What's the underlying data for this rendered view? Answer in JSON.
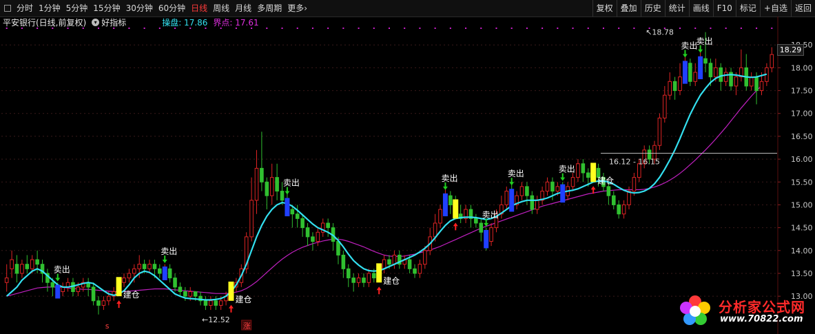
{
  "toolbar": {
    "periods": [
      "分时",
      "1分钟",
      "5分钟",
      "15分钟",
      "30分钟",
      "60分钟",
      "日线",
      "周线",
      "月线",
      "多周期",
      "更多"
    ],
    "active_period": "日线",
    "more_chevron": "›",
    "right_buttons": [
      "复权",
      "叠加",
      "历史",
      "统计",
      "画线",
      "F10",
      "标记",
      "+自选",
      "返回"
    ]
  },
  "infobar": {
    "stock_title": "平安银行(日线,前复权)",
    "indicator_name": "好指标",
    "line1_label": "操盘: 17.86",
    "line2_label": "界点: 17.61"
  },
  "colors": {
    "up": "#e02424",
    "down": "#30c030",
    "fast_line": "#33e0f0",
    "slow_line": "#c020c0",
    "buy_bar": "#ffff20",
    "sell_bar": "#2040ff",
    "grid": "#3a1a1a",
    "axis_text": "#c8c8c8"
  },
  "chart_data": {
    "type": "candlestick",
    "y_axis_ticks": [
      13.0,
      13.5,
      14.0,
      14.5,
      15.0,
      15.5,
      16.0,
      16.5,
      17.0,
      17.5,
      18.0,
      18.5
    ],
    "current_price": "18.29",
    "ylim": [
      12.55,
      18.85
    ],
    "candles": [
      [
        13.3,
        13.4,
        13.1,
        13.7
      ],
      [
        13.6,
        13.8,
        13.4,
        14.0
      ],
      [
        13.7,
        13.5,
        13.3,
        13.9
      ],
      [
        13.5,
        13.7,
        13.4,
        13.8
      ],
      [
        13.7,
        13.6,
        13.5,
        13.9
      ],
      [
        13.6,
        13.8,
        13.5,
        13.9
      ],
      [
        13.8,
        13.7,
        13.5,
        14.0
      ],
      [
        13.7,
        13.5,
        13.3,
        13.8
      ],
      [
        13.5,
        13.3,
        13.1,
        13.6
      ],
      [
        13.3,
        13.2,
        13.0,
        13.4
      ],
      [
        13.2,
        13.1,
        13.0,
        13.3
      ],
      [
        13.1,
        13.2,
        13.0,
        13.3
      ],
      [
        13.2,
        13.3,
        13.1,
        13.4
      ],
      [
        13.3,
        13.1,
        13.0,
        13.4
      ],
      [
        13.1,
        13.2,
        13.0,
        13.3
      ],
      [
        13.2,
        13.3,
        13.1,
        13.4
      ],
      [
        13.3,
        13.2,
        13.0,
        13.4
      ],
      [
        13.2,
        12.9,
        12.8,
        13.3
      ],
      [
        12.9,
        12.8,
        12.6,
        13.0
      ],
      [
        12.8,
        12.9,
        12.7,
        13.0
      ],
      [
        12.9,
        13.0,
        12.8,
        13.1
      ],
      [
        13.0,
        13.1,
        12.9,
        13.2
      ],
      [
        13.1,
        13.3,
        13.0,
        13.4
      ],
      [
        13.3,
        13.4,
        13.2,
        13.5
      ],
      [
        13.4,
        13.5,
        13.3,
        13.6
      ],
      [
        13.5,
        13.6,
        13.3,
        13.7
      ],
      [
        13.6,
        13.7,
        13.4,
        13.9
      ],
      [
        13.7,
        13.6,
        13.5,
        13.8
      ],
      [
        13.6,
        13.7,
        13.5,
        13.8
      ],
      [
        13.7,
        13.6,
        13.4,
        13.8
      ],
      [
        13.6,
        13.5,
        13.4,
        13.7
      ],
      [
        13.5,
        13.6,
        13.4,
        13.7
      ],
      [
        13.6,
        13.4,
        13.3,
        13.7
      ],
      [
        13.4,
        13.2,
        13.1,
        13.5
      ],
      [
        13.2,
        13.1,
        13.0,
        13.3
      ],
      [
        13.1,
        13.0,
        12.9,
        13.2
      ],
      [
        13.0,
        13.1,
        12.9,
        13.2
      ],
      [
        13.1,
        13.0,
        12.9,
        13.1
      ],
      [
        13.0,
        12.9,
        12.8,
        13.1
      ],
      [
        12.9,
        12.8,
        12.7,
        13.0
      ],
      [
        12.8,
        12.9,
        12.7,
        13.0
      ],
      [
        12.9,
        12.8,
        12.7,
        13.0
      ],
      [
        12.8,
        12.9,
        12.7,
        13.0
      ],
      [
        12.9,
        13.0,
        12.8,
        13.1
      ],
      [
        13.0,
        13.2,
        12.9,
        13.3
      ],
      [
        13.2,
        13.3,
        13.1,
        13.4
      ],
      [
        13.3,
        13.6,
        13.2,
        13.7
      ],
      [
        13.6,
        14.3,
        13.5,
        14.4
      ],
      [
        14.3,
        15.1,
        14.2,
        15.6
      ],
      [
        15.1,
        15.8,
        14.8,
        16.2
      ],
      [
        15.8,
        15.5,
        15.3,
        16.6
      ],
      [
        15.5,
        15.2,
        14.9,
        15.6
      ],
      [
        15.2,
        15.6,
        15.0,
        15.9
      ],
      [
        15.6,
        15.3,
        15.1,
        15.9
      ],
      [
        15.3,
        15.1,
        15.0,
        15.5
      ],
      [
        15.1,
        14.9,
        14.8,
        15.3
      ],
      [
        14.9,
        14.8,
        14.5,
        15.0
      ],
      [
        14.8,
        14.7,
        14.5,
        15.0
      ],
      [
        14.7,
        14.5,
        14.3,
        14.8
      ],
      [
        14.5,
        14.3,
        14.1,
        14.6
      ],
      [
        14.3,
        14.2,
        14.0,
        14.4
      ],
      [
        14.2,
        14.4,
        14.1,
        14.5
      ],
      [
        14.4,
        14.6,
        14.3,
        14.7
      ],
      [
        14.6,
        14.5,
        14.3,
        14.7
      ],
      [
        14.5,
        14.2,
        14.0,
        14.6
      ],
      [
        14.2,
        13.9,
        13.7,
        14.3
      ],
      [
        13.9,
        13.6,
        13.4,
        14.0
      ],
      [
        13.6,
        13.4,
        13.2,
        13.7
      ],
      [
        13.4,
        13.3,
        13.1,
        13.5
      ],
      [
        13.3,
        13.4,
        13.2,
        13.5
      ],
      [
        13.4,
        13.3,
        13.2,
        13.5
      ],
      [
        13.3,
        13.5,
        13.2,
        13.6
      ],
      [
        13.5,
        13.4,
        13.3,
        13.6
      ],
      [
        13.4,
        13.6,
        13.3,
        13.7
      ],
      [
        13.6,
        13.8,
        13.5,
        13.9
      ],
      [
        13.8,
        13.7,
        13.6,
        13.9
      ],
      [
        13.7,
        13.9,
        13.6,
        14.0
      ],
      [
        13.9,
        13.7,
        13.6,
        14.0
      ],
      [
        13.7,
        13.8,
        13.6,
        13.9
      ],
      [
        13.8,
        13.6,
        13.5,
        13.9
      ],
      [
        13.6,
        13.5,
        13.4,
        13.7
      ],
      [
        13.5,
        13.7,
        13.4,
        13.8
      ],
      [
        13.7,
        14.0,
        13.6,
        14.1
      ],
      [
        14.0,
        14.3,
        13.9,
        14.5
      ],
      [
        14.3,
        14.6,
        14.2,
        14.8
      ],
      [
        14.6,
        14.9,
        14.5,
        15.0
      ],
      [
        14.9,
        15.2,
        14.8,
        15.4
      ],
      [
        15.2,
        15.0,
        14.8,
        15.3
      ],
      [
        15.0,
        14.8,
        14.7,
        15.2
      ],
      [
        14.8,
        14.7,
        14.6,
        15.0
      ],
      [
        14.7,
        14.9,
        14.6,
        15.0
      ],
      [
        14.9,
        14.7,
        14.5,
        15.0
      ],
      [
        14.7,
        14.6,
        14.5,
        14.8
      ],
      [
        14.6,
        14.4,
        14.2,
        14.7
      ],
      [
        14.4,
        14.2,
        14.0,
        14.5
      ],
      [
        14.2,
        14.5,
        14.1,
        14.6
      ],
      [
        14.5,
        14.8,
        14.4,
        14.9
      ],
      [
        14.8,
        15.0,
        14.7,
        15.2
      ],
      [
        15.0,
        15.3,
        14.9,
        15.4
      ],
      [
        15.3,
        15.0,
        14.9,
        15.5
      ],
      [
        15.0,
        15.2,
        14.9,
        15.3
      ],
      [
        15.2,
        15.4,
        15.1,
        15.5
      ],
      [
        15.4,
        15.2,
        15.0,
        15.5
      ],
      [
        15.2,
        14.9,
        14.8,
        15.3
      ],
      [
        14.9,
        15.1,
        14.8,
        15.2
      ],
      [
        15.1,
        15.3,
        15.0,
        15.4
      ],
      [
        15.3,
        15.5,
        15.2,
        15.6
      ],
      [
        15.5,
        15.3,
        15.1,
        15.6
      ],
      [
        15.3,
        15.4,
        15.2,
        15.5
      ],
      [
        15.4,
        15.2,
        15.1,
        15.5
      ],
      [
        15.2,
        15.4,
        15.1,
        15.5
      ],
      [
        15.4,
        15.6,
        15.3,
        15.7
      ],
      [
        15.6,
        15.9,
        15.5,
        16.0
      ],
      [
        15.9,
        15.7,
        15.5,
        16.0
      ],
      [
        15.7,
        15.6,
        15.4,
        15.8
      ],
      [
        15.6,
        15.8,
        15.5,
        15.9
      ],
      [
        15.8,
        15.6,
        15.4,
        15.9
      ],
      [
        15.6,
        15.4,
        15.3,
        15.7
      ],
      [
        15.4,
        15.2,
        15.0,
        15.5
      ],
      [
        15.2,
        15.0,
        14.9,
        15.3
      ],
      [
        15.0,
        14.8,
        14.7,
        15.1
      ],
      [
        14.8,
        15.0,
        14.7,
        15.1
      ],
      [
        15.0,
        15.3,
        14.9,
        15.4
      ],
      [
        15.3,
        15.6,
        15.2,
        15.7
      ],
      [
        15.6,
        15.9,
        15.5,
        16.0
      ],
      [
        15.9,
        16.2,
        15.8,
        16.3
      ],
      [
        16.2,
        16.0,
        15.9,
        16.3
      ],
      [
        16.0,
        16.3,
        15.9,
        16.4
      ],
      [
        16.3,
        16.9,
        16.2,
        17.0
      ],
      [
        16.9,
        17.4,
        16.8,
        17.6
      ],
      [
        17.4,
        17.7,
        17.3,
        17.9
      ],
      [
        17.7,
        17.5,
        17.3,
        17.8
      ],
      [
        17.5,
        17.8,
        17.4,
        18.1
      ],
      [
        17.8,
        18.1,
        17.7,
        18.3
      ],
      [
        18.1,
        17.7,
        17.6,
        18.2
      ],
      [
        17.7,
        17.9,
        17.6,
        18.1
      ],
      [
        17.9,
        18.2,
        17.8,
        18.4
      ],
      [
        18.2,
        18.1,
        17.9,
        18.78
      ],
      [
        18.1,
        17.8,
        17.6,
        18.2
      ],
      [
        17.8,
        18.0,
        17.7,
        18.2
      ],
      [
        18.0,
        17.7,
        17.5,
        18.1
      ],
      [
        17.7,
        17.9,
        17.6,
        18.0
      ],
      [
        17.9,
        17.6,
        17.5,
        18.0
      ],
      [
        17.6,
        17.8,
        17.4,
        17.9
      ],
      [
        17.8,
        18.0,
        17.7,
        18.4
      ],
      [
        18.0,
        17.6,
        17.5,
        18.3
      ],
      [
        17.6,
        17.8,
        17.5,
        17.9
      ],
      [
        17.8,
        17.5,
        17.2,
        17.9
      ],
      [
        17.5,
        17.7,
        17.4,
        17.9
      ],
      [
        17.7,
        18.0,
        17.6,
        18.1
      ],
      [
        18.0,
        18.29,
        17.9,
        18.45
      ]
    ],
    "fast_line": [
      13.0,
      13.1,
      13.2,
      13.35,
      13.45,
      13.55,
      13.6,
      13.55,
      13.45,
      13.35,
      13.25,
      13.2,
      13.2,
      13.22,
      13.25,
      13.28,
      13.3,
      13.28,
      13.2,
      13.12,
      13.05,
      13.02,
      13.05,
      13.12,
      13.25,
      13.4,
      13.5,
      13.55,
      13.52,
      13.45,
      13.35,
      13.25,
      13.15,
      13.05,
      13.0,
      12.96,
      12.95,
      12.94,
      12.93,
      12.92,
      12.92,
      12.93,
      12.95,
      13.0,
      13.1,
      13.25,
      13.45,
      13.7,
      14.0,
      14.3,
      14.55,
      14.75,
      14.9,
      15.0,
      15.05,
      15.03,
      14.97,
      14.88,
      14.78,
      14.68,
      14.58,
      14.5,
      14.45,
      14.4,
      14.33,
      14.22,
      14.08,
      13.92,
      13.78,
      13.68,
      13.6,
      13.56,
      13.55,
      13.56,
      13.6,
      13.65,
      13.7,
      13.75,
      13.8,
      13.85,
      13.9,
      13.97,
      14.05,
      14.15,
      14.28,
      14.42,
      14.55,
      14.65,
      14.7,
      14.72,
      14.73,
      14.73,
      14.72,
      14.7,
      14.68,
      14.7,
      14.75,
      14.82,
      14.9,
      14.98,
      15.03,
      15.07,
      15.1,
      15.1,
      15.1,
      15.12,
      15.15,
      15.2,
      15.25,
      15.28,
      15.3,
      15.32,
      15.35,
      15.4,
      15.45,
      15.5,
      15.52,
      15.52,
      15.5,
      15.45,
      15.38,
      15.32,
      15.28,
      15.26,
      15.27,
      15.3,
      15.36,
      15.46,
      15.6,
      15.78,
      15.98,
      16.2,
      16.45,
      16.72,
      16.98,
      17.2,
      17.4,
      17.55,
      17.68,
      17.77,
      17.82,
      17.84,
      17.85,
      17.84,
      17.82,
      17.8,
      17.79,
      17.8,
      17.83,
      17.86
    ],
    "slow_line": [
      13.0,
      13.03,
      13.06,
      13.09,
      13.12,
      13.15,
      13.18,
      13.19,
      13.2,
      13.2,
      13.2,
      13.19,
      13.18,
      13.17,
      13.16,
      13.15,
      13.15,
      13.14,
      13.13,
      13.12,
      13.11,
      13.1,
      13.1,
      13.1,
      13.11,
      13.12,
      13.13,
      13.14,
      13.15,
      13.16,
      13.16,
      13.16,
      13.15,
      13.14,
      13.13,
      13.12,
      13.11,
      13.1,
      13.09,
      13.08,
      13.07,
      13.06,
      13.06,
      13.06,
      13.07,
      13.09,
      13.12,
      13.17,
      13.24,
      13.32,
      13.42,
      13.52,
      13.62,
      13.72,
      13.81,
      13.89,
      13.96,
      14.02,
      14.07,
      14.11,
      14.15,
      14.18,
      14.21,
      14.23,
      14.25,
      14.25,
      14.23,
      14.2,
      14.16,
      14.12,
      14.08,
      14.03,
      13.98,
      13.94,
      13.9,
      13.88,
      13.87,
      13.87,
      13.88,
      13.9,
      13.92,
      13.95,
      13.98,
      14.01,
      14.05,
      14.09,
      14.14,
      14.19,
      14.24,
      14.29,
      14.34,
      14.39,
      14.44,
      14.49,
      14.53,
      14.57,
      14.61,
      14.65,
      14.69,
      14.73,
      14.77,
      14.81,
      14.85,
      14.89,
      14.93,
      14.97,
      15.0,
      15.03,
      15.06,
      15.09,
      15.12,
      15.15,
      15.18,
      15.21,
      15.24,
      15.26,
      15.28,
      15.3,
      15.31,
      15.32,
      15.33,
      15.33,
      15.33,
      15.33,
      15.33,
      15.34,
      15.36,
      15.39,
      15.43,
      15.48,
      15.54,
      15.61,
      15.69,
      15.78,
      15.88,
      15.98,
      16.09,
      16.2,
      16.32,
      16.44,
      16.57,
      16.7,
      16.84,
      16.98,
      17.12,
      17.25,
      17.38,
      17.5,
      17.61
    ],
    "buy_markers": [
      {
        "i": 22,
        "text": "建仓"
      },
      {
        "i": 44,
        "text": "建仓"
      },
      {
        "i": 73,
        "text": "建仓"
      },
      {
        "i": 88,
        "text": ""
      },
      {
        "i": 115,
        "text": "建仓"
      }
    ],
    "sell_markers": [
      {
        "i": 10,
        "text": "卖出"
      },
      {
        "i": 31,
        "text": "卖出"
      },
      {
        "i": 55,
        "text": "卖出"
      },
      {
        "i": 86,
        "text": "卖出"
      },
      {
        "i": 94,
        "text": "卖出"
      },
      {
        "i": 99,
        "text": "卖出"
      },
      {
        "i": 109,
        "text": "卖出"
      },
      {
        "i": 133,
        "text": "卖出"
      },
      {
        "i": 136,
        "text": "卖出"
      }
    ],
    "price_annotations": [
      {
        "i": 38,
        "price": 12.52,
        "text": "12.52",
        "dir": "left"
      },
      {
        "i": 125,
        "price": 18.78,
        "text": "18.78",
        "dir": "right"
      }
    ],
    "range_label": {
      "i": 117,
      "price": 16.12,
      "text": "16.12 - 16.15",
      "hline_price": 16.13
    },
    "bottom_markers": [
      {
        "i": 20,
        "text": "s"
      },
      {
        "i": 47,
        "text": "涨"
      }
    ]
  },
  "watermark": {
    "title": "分析家公式网",
    "url": "www.70822.com"
  }
}
